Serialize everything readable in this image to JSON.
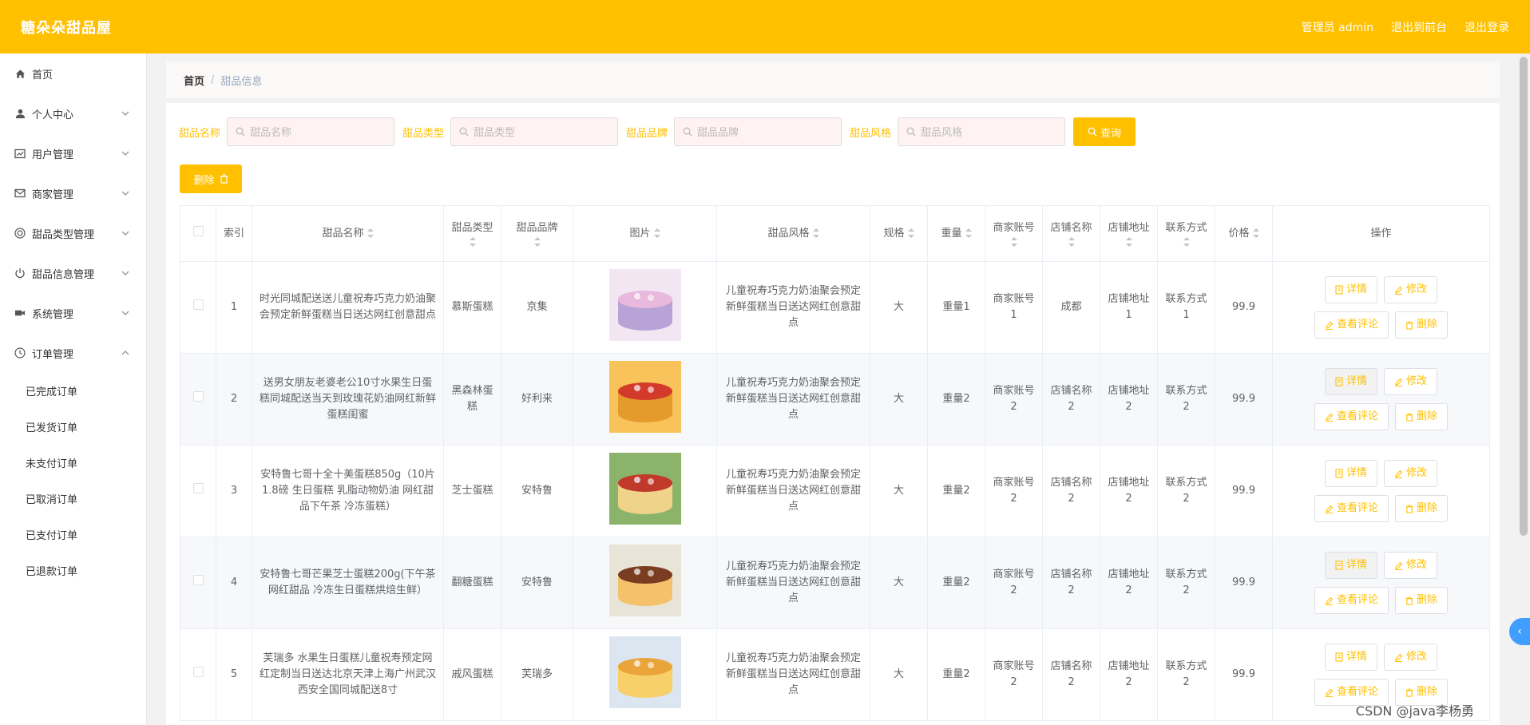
{
  "header": {
    "title": "糖朵朵甜品屋",
    "admin": "管理员 admin",
    "front": "退出到前台",
    "logout": "退出登录"
  },
  "sidebar": {
    "items": [
      {
        "label": "首页"
      },
      {
        "label": "个人中心"
      },
      {
        "label": "用户管理"
      },
      {
        "label": "商家管理"
      },
      {
        "label": "甜品类型管理"
      },
      {
        "label": "甜品信息管理"
      },
      {
        "label": "系统管理"
      },
      {
        "label": "订单管理"
      }
    ],
    "sub": [
      {
        "label": "已完成订单"
      },
      {
        "label": "已发货订单"
      },
      {
        "label": "未支付订单"
      },
      {
        "label": "已取消订单"
      },
      {
        "label": "已支付订单"
      },
      {
        "label": "已退款订单"
      }
    ]
  },
  "breadcrumb": {
    "home": "首页",
    "sep": "/",
    "current": "甜品信息"
  },
  "search": {
    "name_label": "甜品名称",
    "name_ph": "甜品名称",
    "type_label": "甜品类型",
    "type_ph": "甜品类型",
    "brand_label": "甜品品牌",
    "brand_ph": "甜品品牌",
    "style_label": "甜品风格",
    "style_ph": "甜品风格",
    "query": "查询"
  },
  "toolbar": {
    "delete": "删除"
  },
  "table": {
    "headers": [
      "索引",
      "甜品名称",
      "甜品类型",
      "甜品品牌",
      "图片",
      "甜品风格",
      "规格",
      "重量",
      "商家账号",
      "店铺名称",
      "店铺地址",
      "联系方式",
      "价格",
      "操作"
    ],
    "rows": [
      {
        "idx": "1",
        "name": "时光同城配送送儿童祝寿巧克力奶油聚会预定新鲜蛋糕当日送达网红创意甜点",
        "type": "慕斯蛋糕",
        "brand": "京集",
        "style": "儿童祝寿巧克力奶油聚会预定新鲜蛋糕当日送达网红创意甜点",
        "spec": "大",
        "weight": "重量1",
        "account": "商家账号1",
        "shop": "成都",
        "addr": "店铺地址1",
        "contact": "联系方式1",
        "price": "99.9"
      },
      {
        "idx": "2",
        "name": "送男女朋友老婆老公10寸水果生日蛋糕同城配送当天到玫瑰花奶油网红新鲜蛋糕闺蜜",
        "type": "黑森林蛋糕",
        "brand": "好利来",
        "style": "儿童祝寿巧克力奶油聚会预定新鲜蛋糕当日送达网红创意甜点",
        "spec": "大",
        "weight": "重量2",
        "account": "商家账号2",
        "shop": "店铺名称2",
        "addr": "店铺地址2",
        "contact": "联系方式2",
        "price": "99.9"
      },
      {
        "idx": "3",
        "name": "安特鲁七哥十全十美蛋糕850g（10片1.8磅 生日蛋糕 乳脂动物奶油 网红甜品下午茶 冷冻蛋糕）",
        "type": "芝士蛋糕",
        "brand": "安特鲁",
        "style": "儿童祝寿巧克力奶油聚会预定新鲜蛋糕当日送达网红创意甜点",
        "spec": "大",
        "weight": "重量2",
        "account": "商家账号2",
        "shop": "店铺名称2",
        "addr": "店铺地址2",
        "contact": "联系方式2",
        "price": "99.9"
      },
      {
        "idx": "4",
        "name": "安特鲁七哥芒果芝士蛋糕200g(下午茶 网红甜品 冷冻生日蛋糕烘焙生鲜）",
        "type": "翻糖蛋糕",
        "brand": "安特鲁",
        "style": "儿童祝寿巧克力奶油聚会预定新鲜蛋糕当日送达网红创意甜点",
        "spec": "大",
        "weight": "重量2",
        "account": "商家账号2",
        "shop": "店铺名称2",
        "addr": "店铺地址2",
        "contact": "联系方式2",
        "price": "99.9"
      },
      {
        "idx": "5",
        "name": "芙瑞多 水果生日蛋糕儿童祝寿预定网红定制当日送达北京天津上海广州武汉西安全国同城配送8寸",
        "type": "戚风蛋糕",
        "brand": "芙瑞多",
        "style": "儿童祝寿巧克力奶油聚会预定新鲜蛋糕当日送达网红创意甜点",
        "spec": "大",
        "weight": "重量2",
        "account": "商家账号2",
        "shop": "店铺名称2",
        "addr": "店铺地址2",
        "contact": "联系方式2",
        "price": "99.9"
      }
    ],
    "ops": {
      "detail": "详情",
      "edit": "修改",
      "review": "查看评论",
      "del": "删除"
    }
  },
  "watermark": "CSDN @java李杨勇",
  "colors": {
    "accent": "#ffc000",
    "float": "#409eff"
  }
}
